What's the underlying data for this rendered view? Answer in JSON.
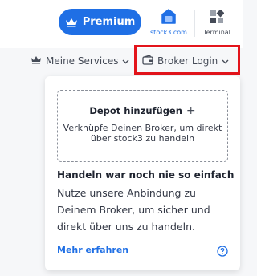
{
  "header": {
    "premium_label": "Premium",
    "apps": [
      {
        "label": "stock3.com",
        "icon": "stock3-house-icon"
      },
      {
        "label": "Terminal",
        "icon": "terminal-grid-icon"
      }
    ]
  },
  "nav": {
    "services_label": "Meine Services",
    "broker_label": "Broker Login"
  },
  "dropdown": {
    "add_depot_title": "Depot hinzufügen",
    "add_depot_description": "Verknüpfe Deinen Broker, um direkt über stock3 zu handeln",
    "promo_heading": "Handeln war noch nie so einfach",
    "promo_text": "Nutze unsere Anbindung zu Deinem Broker, um sicher und direkt über uns zu handeln.",
    "learn_more_label": "Mehr erfahren"
  },
  "colors": {
    "accent": "#1f6fe5",
    "highlight": "#e3141b"
  }
}
